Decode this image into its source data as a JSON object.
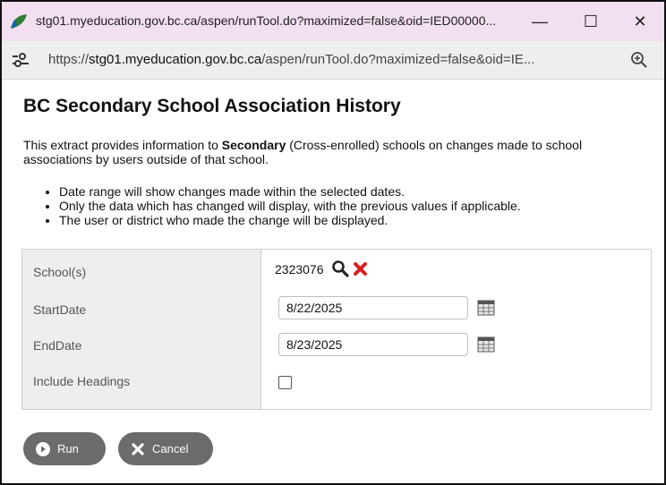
{
  "window": {
    "title": "stg01.myeducation.gov.bc.ca/aspen/runTool.do?maximized=false&oid=IED00000...",
    "minimize_glyph": "—",
    "maximize_glyph": "☐",
    "close_glyph": "✕"
  },
  "address": {
    "scheme": "https://",
    "host": "stg01.myeducation.gov.bc.ca",
    "path": "/aspen/runTool.do?maximized=false&oid=IE..."
  },
  "page": {
    "title": "BC Secondary School Association History",
    "description_prefix": "This extract provides information to ",
    "description_bold": "Secondary",
    "description_suffix": " (Cross-enrolled) schools on changes made to school associations by users outside of that school.",
    "bullets": [
      "Date range will show changes made within the selected dates.",
      "Only the data which has changed will display, with the previous values if applicable.",
      "The user or district who made the change will be displayed."
    ]
  },
  "params": {
    "school_label": "School(s)",
    "school_value": "2323076",
    "start_label": "StartDate",
    "start_value": "8/22/2025",
    "end_label": "EndDate",
    "end_value": "8/23/2025",
    "headings_label": "Include Headings",
    "headings_checked": false
  },
  "buttons": {
    "run_label": "Run",
    "cancel_label": "Cancel"
  },
  "colors": {
    "titlebar_bg": "#f2dff0",
    "button_bg": "#6b6b6b",
    "delete_red": "#d81f1f"
  },
  "icons": [
    "app-logo-icon",
    "site-settings-icon",
    "zoom-icon",
    "search-icon",
    "delete-icon",
    "calendar-icon",
    "play-circle-icon",
    "x-icon"
  ]
}
